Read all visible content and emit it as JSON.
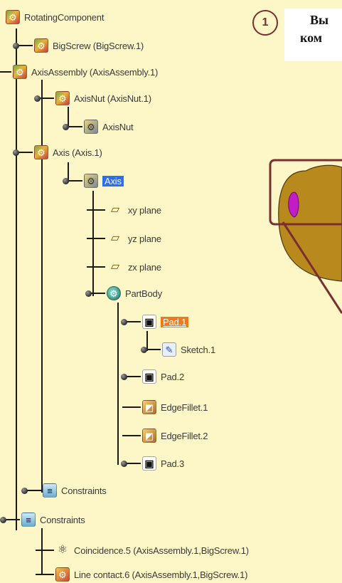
{
  "callout": {
    "number": "1"
  },
  "note": {
    "line1": "Вы",
    "line2": "ком"
  },
  "tree": {
    "items": [
      {
        "id": "root",
        "label": "RotatingComponent",
        "icon": "product-icon"
      },
      {
        "id": "bigscrew",
        "label": "BigScrew (BigScrew.1)",
        "icon": "product-icon"
      },
      {
        "id": "axisassembly",
        "label": "AxisAssembly (AxisAssembly.1)",
        "icon": "product-icon"
      },
      {
        "id": "axisnut",
        "label": "AxisNut (AxisNut.1)",
        "icon": "product-icon"
      },
      {
        "id": "axisnut-part",
        "label": "AxisNut",
        "icon": "gear-icon"
      },
      {
        "id": "axis",
        "label": "Axis (Axis.1)",
        "icon": "product-icon"
      },
      {
        "id": "axis-part",
        "label": "Axis",
        "icon": "gear-icon",
        "selected": true
      },
      {
        "id": "xy",
        "label": "xy plane",
        "icon": "plane-icon"
      },
      {
        "id": "yz",
        "label": "yz plane",
        "icon": "plane-icon"
      },
      {
        "id": "zx",
        "label": "zx plane",
        "icon": "plane-icon"
      },
      {
        "id": "partbody",
        "label": "PartBody",
        "icon": "partbody-icon"
      },
      {
        "id": "pad1",
        "label": "Pad.1",
        "icon": "pad-icon",
        "highlighted": true
      },
      {
        "id": "sketch1",
        "label": "Sketch.1",
        "icon": "sketch-icon"
      },
      {
        "id": "pad2",
        "label": "Pad.2",
        "icon": "pad-icon"
      },
      {
        "id": "edgefillet1",
        "label": "EdgeFillet.1",
        "icon": "edgefillet-icon"
      },
      {
        "id": "edgefillet2",
        "label": "EdgeFillet.2",
        "icon": "edgefillet-icon"
      },
      {
        "id": "pad3",
        "label": "Pad.3",
        "icon": "pad-icon"
      },
      {
        "id": "constraints-inner",
        "label": "Constraints",
        "icon": "constraints-icon"
      },
      {
        "id": "constraints",
        "label": "Constraints",
        "icon": "constraints-icon"
      },
      {
        "id": "coincidence",
        "label": "Coincidence.5 (AxisAssembly.1,BigScrew.1)",
        "icon": "coincidence-icon"
      },
      {
        "id": "linecontact",
        "label": "Line contact.6 (AxisAssembly.1,BigScrew.1)",
        "icon": "line-contact-icon"
      }
    ]
  },
  "colors": {
    "background": "#fdf6c7",
    "selection": "#2b6ef0",
    "highlight": "#f07a18",
    "callout": "#7a2f2f",
    "part_face": "#b88a1e",
    "part_accent": "#c01cc8"
  }
}
